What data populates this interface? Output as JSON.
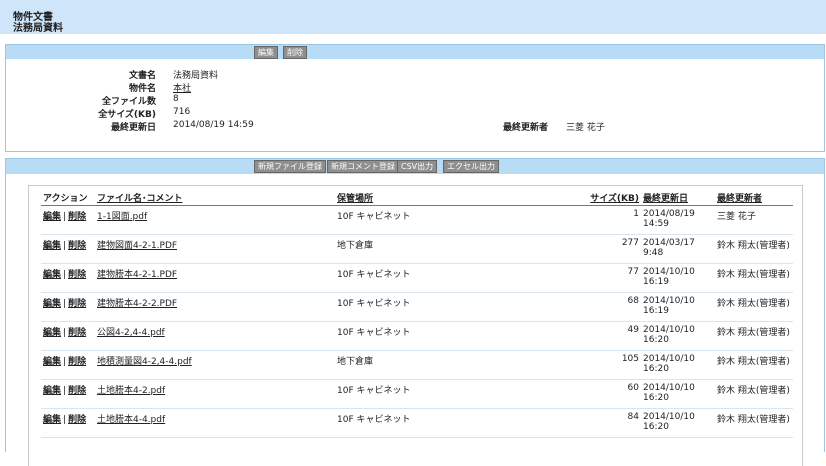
{
  "header": {
    "category": "物件文書",
    "title": "法務局資料"
  },
  "detail": {
    "edit_label": "編集",
    "delete_label": "削除",
    "doc_name_label": "文書名",
    "doc_name": "法務局資料",
    "property_label": "物件名",
    "property_name": "本社",
    "file_count_label": "全ファイル数",
    "file_count": "8",
    "size_label": "全サイズ(KB)",
    "size": "716",
    "updated_label": "最終更新日",
    "updated": "2014/08/19 14:59",
    "updater_label": "最終更新者",
    "updater": "三菱 花子"
  },
  "toolbar": {
    "new_file": "新規ファイル登録",
    "new_comment": "新規コメント登録",
    "csv": "CSV出力",
    "excel": "エクセル出力"
  },
  "table": {
    "headers": {
      "action": "アクション",
      "file": "ファイル名･コメント",
      "location": "保管場所",
      "size": "サイズ(KB)",
      "updated": "最終更新日",
      "updater": "最終更新者"
    },
    "edit": "編集",
    "delete": "削除",
    "sep": "|",
    "rows": [
      {
        "file": "1-1図面.pdf",
        "location": "10F キャビネット",
        "size": "1",
        "updated": "2014/08/19 14:59",
        "updater": "三菱 花子"
      },
      {
        "file": "建物図面4-2-1.PDF",
        "location": "地下倉庫",
        "size": "277",
        "updated": "2014/03/17 9:48",
        "updater": "鈴木 翔太(管理者)"
      },
      {
        "file": "建物謄本4-2-1.PDF",
        "location": "10F キャビネット",
        "size": "77",
        "updated": "2014/10/10 16:19",
        "updater": "鈴木 翔太(管理者)"
      },
      {
        "file": "建物謄本4-2-2.PDF",
        "location": "10F キャビネット",
        "size": "68",
        "updated": "2014/10/10 16:19",
        "updater": "鈴木 翔太(管理者)"
      },
      {
        "file": "公図4-2,4-4.pdf",
        "location": "10F キャビネット",
        "size": "49",
        "updated": "2014/10/10 16:20",
        "updater": "鈴木 翔太(管理者)"
      },
      {
        "file": "地積測量図4-2,4-4.pdf",
        "location": "地下倉庫",
        "size": "105",
        "updated": "2014/10/10 16:20",
        "updater": "鈴木 翔太(管理者)"
      },
      {
        "file": "土地謄本4-2.pdf",
        "location": "10F キャビネット",
        "size": "60",
        "updated": "2014/10/10 16:20",
        "updater": "鈴木 翔太(管理者)"
      },
      {
        "file": "土地謄本4-4.pdf",
        "location": "10F キャビネット",
        "size": "84",
        "updated": "2014/10/10 16:20",
        "updater": "鈴木 翔太(管理者)"
      }
    ]
  }
}
